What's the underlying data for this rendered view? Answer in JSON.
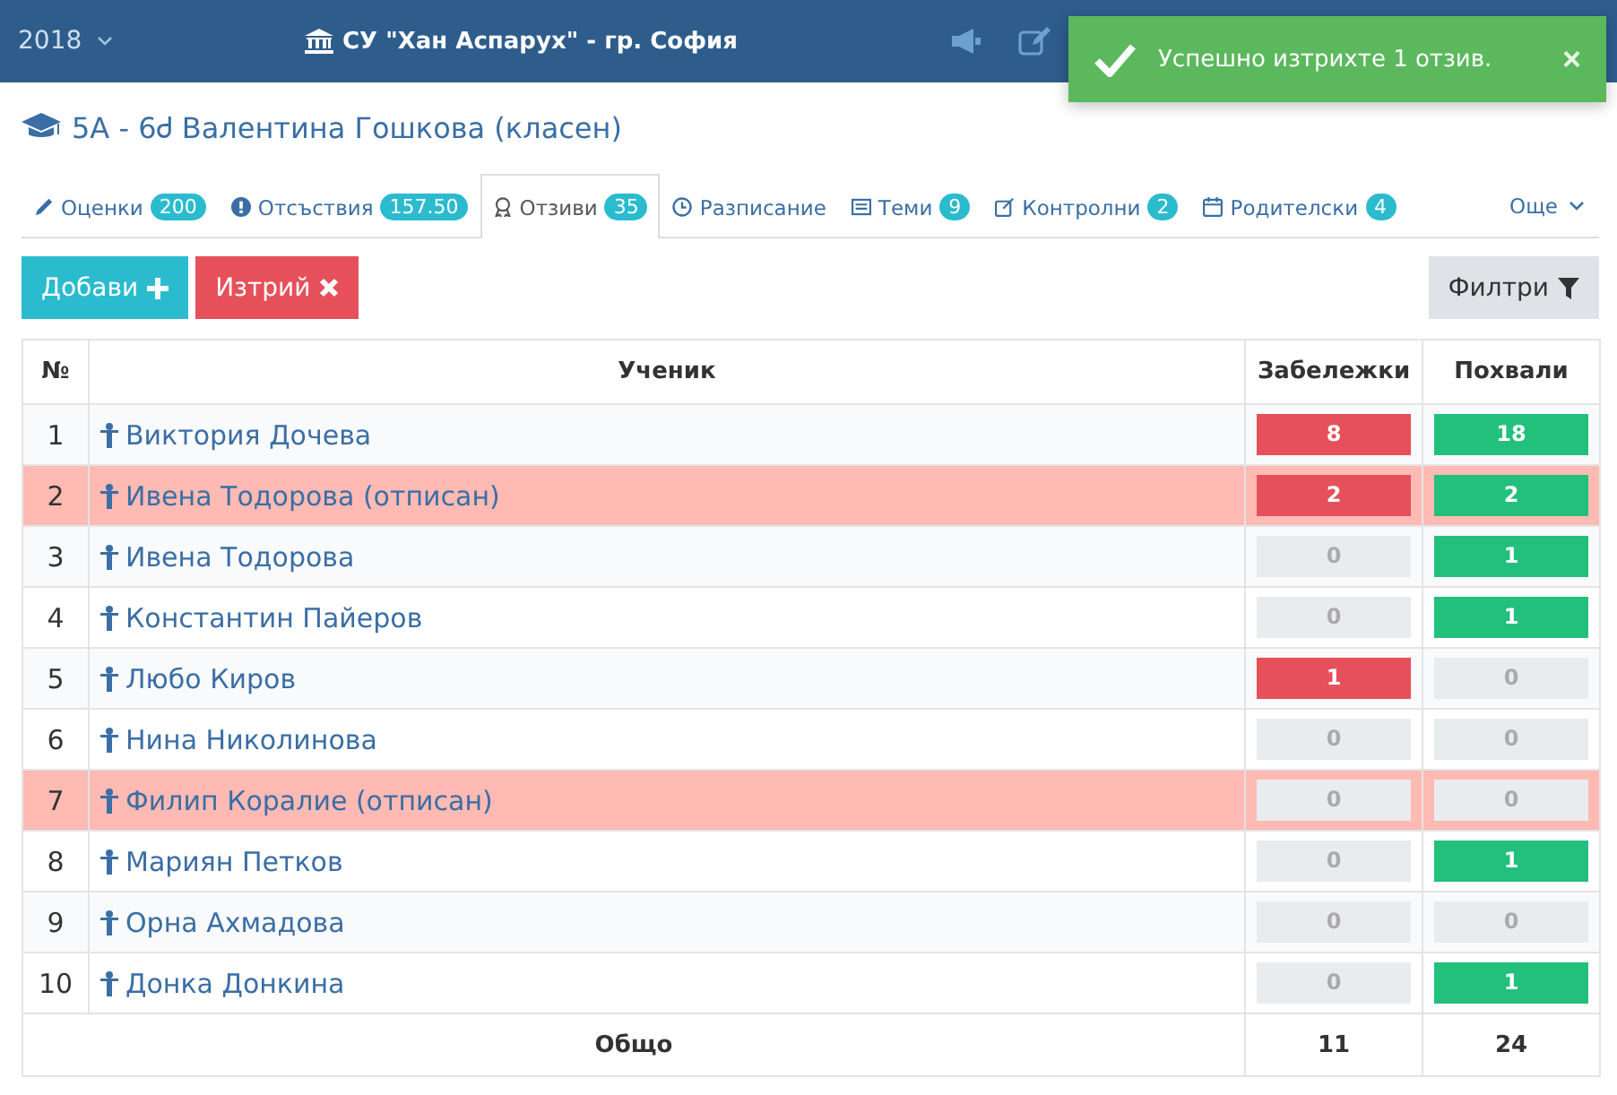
{
  "header": {
    "year": "2018",
    "school": "СУ \"Хан Аспарух\" - гр. София"
  },
  "toast": {
    "message": "Успешно изтрихте 1 отзив.",
    "close": "×"
  },
  "page_title": "5А - 6Ꮷ Валентина Гошкова (класен)",
  "tabs": [
    {
      "label": "Оценки",
      "badge": "200",
      "selected": false
    },
    {
      "label": "Отсъствия",
      "badge": "157.50",
      "selected": false
    },
    {
      "label": "Отзиви",
      "badge": "35",
      "selected": true
    },
    {
      "label": "Разписание",
      "selected": false
    },
    {
      "label": "Теми",
      "badge": "9",
      "selected": false
    },
    {
      "label": "Контролни",
      "badge": "2",
      "selected": false
    },
    {
      "label": "Родителски",
      "badge": "4",
      "selected": false
    }
  ],
  "more": "Още",
  "buttons": {
    "add": "Добави",
    "delete": "Изтрий",
    "filters": "Филтри"
  },
  "table": {
    "columns": [
      "№",
      "Ученик",
      "Забележки",
      "Похвали"
    ],
    "rows": [
      {
        "no": "1",
        "name": "Виктория Дочева",
        "withdrawn": false,
        "remarks": {
          "value": "8",
          "kind": "filled"
        },
        "praises": {
          "value": "18",
          "kind": "filled"
        }
      },
      {
        "no": "2",
        "name": "Ивена Тодорова (отписан)",
        "withdrawn": true,
        "remarks": {
          "value": "2",
          "kind": "filled"
        },
        "praises": {
          "value": "2",
          "kind": "filled"
        }
      },
      {
        "no": "3",
        "name": "Ивена Тодорова",
        "withdrawn": false,
        "remarks": {
          "value": "0",
          "kind": "empty"
        },
        "praises": {
          "value": "1",
          "kind": "filled"
        }
      },
      {
        "no": "4",
        "name": "Константин Пайеров",
        "withdrawn": false,
        "remarks": {
          "value": "0",
          "kind": "empty"
        },
        "praises": {
          "value": "1",
          "kind": "filled"
        }
      },
      {
        "no": "5",
        "name": "Любо Киров",
        "withdrawn": false,
        "remarks": {
          "value": "1",
          "kind": "filled"
        },
        "praises": {
          "value": "0",
          "kind": "empty"
        }
      },
      {
        "no": "6",
        "name": "Нина Николинова",
        "withdrawn": false,
        "remarks": {
          "value": "0",
          "kind": "empty"
        },
        "praises": {
          "value": "0",
          "kind": "empty"
        }
      },
      {
        "no": "7",
        "name": "Филип Коралие (отписан)",
        "withdrawn": true,
        "remarks": {
          "value": "0",
          "kind": "empty"
        },
        "praises": {
          "value": "0",
          "kind": "empty"
        }
      },
      {
        "no": "8",
        "name": "Мариян Петков",
        "withdrawn": false,
        "remarks": {
          "value": "0",
          "kind": "empty"
        },
        "praises": {
          "value": "1",
          "kind": "filled"
        }
      },
      {
        "no": "9",
        "name": "Орна Ахмадова",
        "withdrawn": false,
        "remarks": {
          "value": "0",
          "kind": "empty"
        },
        "praises": {
          "value": "0",
          "kind": "empty"
        }
      },
      {
        "no": "10",
        "name": "Донка Донкина",
        "withdrawn": false,
        "remarks": {
          "value": "0",
          "kind": "empty"
        },
        "praises": {
          "value": "1",
          "kind": "filled"
        }
      }
    ],
    "total": {
      "label": "Общо",
      "remarks": "11",
      "praises": "24"
    }
  }
}
